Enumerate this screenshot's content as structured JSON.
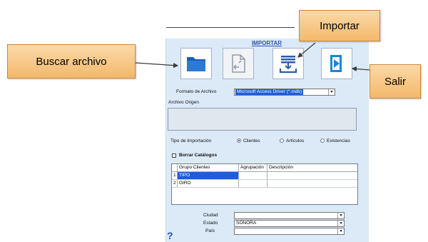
{
  "panel_title": "IMPORTAR",
  "toolbar": {
    "buscar_icon": "folder-icon",
    "convert_icon": "document-convert-icon",
    "import_icon": "import-tray-icon",
    "exit_icon": "exit-door-icon"
  },
  "form": {
    "formato_label": "Formato de Archivo",
    "formato_value": "Microsoft Access Driver (*.mdb)",
    "archivo_origen_label": "Archivo Origen",
    "archivo_origen_value": "",
    "tipo_label": "Tipo de Importación",
    "options": [
      {
        "label": "Clientes",
        "selected": true
      },
      {
        "label": "Artículos",
        "selected": false
      },
      {
        "label": "Existencias",
        "selected": false
      }
    ],
    "borrar_label": "Borrar Catálogos"
  },
  "grid": {
    "headers": [
      "Grupo Clientes",
      "Agrupación",
      "Descripción"
    ],
    "rows": [
      {
        "num": "1",
        "grupo": "TIPO",
        "agrupacion": "",
        "descripcion": ""
      },
      {
        "num": "2",
        "grupo": "GIRO",
        "agrupacion": "",
        "descripcion": ""
      }
    ]
  },
  "location": {
    "ciudad_label": "Ciudad",
    "ciudad_value": "",
    "estado_label": "Estado",
    "estado_value": "SONORA",
    "pais_label": "País",
    "pais_value": ""
  },
  "callouts": {
    "buscar": "Buscar archivo",
    "importar": "Importar",
    "salir": "Salir"
  },
  "help_symbol": "?",
  "colors": {
    "panel_bg": "#dce9f7",
    "accent_blue": "#1c5fd6",
    "callout_orange": "#f3b96b"
  }
}
